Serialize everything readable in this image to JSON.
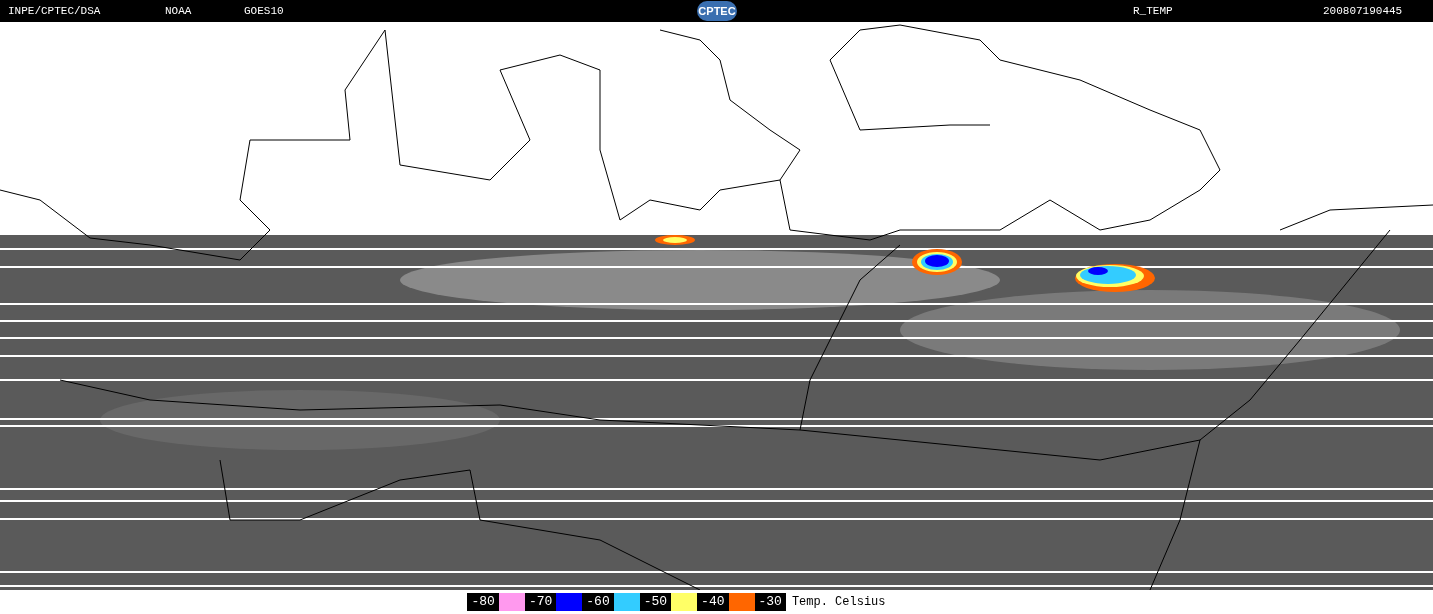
{
  "header": {
    "source": "INPE/CPTEC/DSA",
    "agency": "NOAA",
    "satellite": "GOES10",
    "logo": "CPTEC",
    "product": "R_TEMP",
    "timestamp": "200807190445"
  },
  "legend": {
    "steps": [
      {
        "label": "-80",
        "color": "#ff99ee"
      },
      {
        "label": "-70",
        "color": "#0000ff"
      },
      {
        "label": "-60",
        "color": "#33ccff"
      },
      {
        "label": "-50",
        "color": "#ffff66"
      },
      {
        "label": "-40",
        "color": "#ff6600"
      },
      {
        "label": "-30"
      }
    ],
    "unit": "Temp. Celsius"
  }
}
